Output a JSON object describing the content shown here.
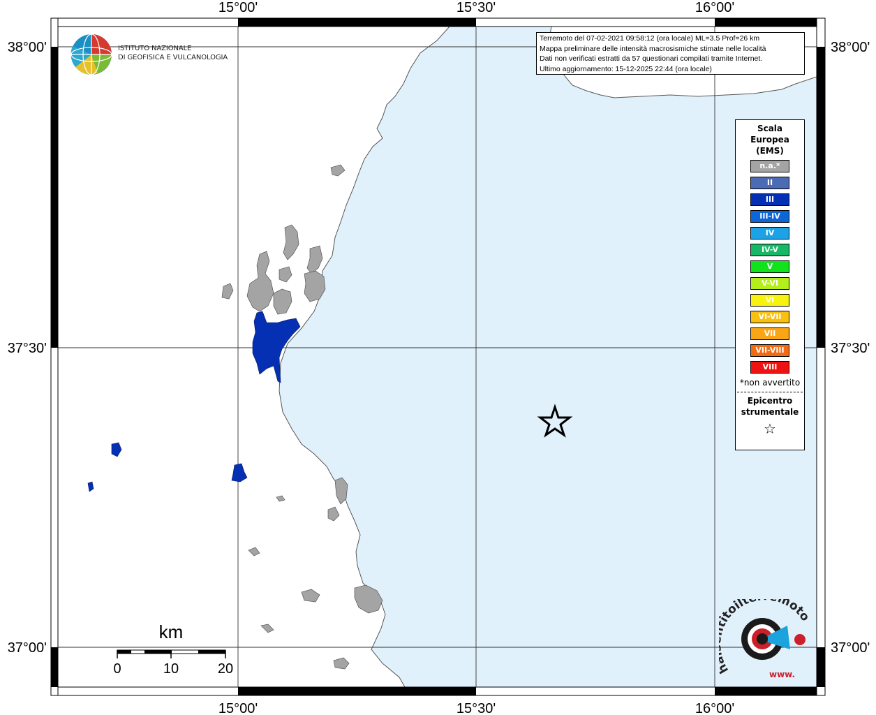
{
  "map": {
    "top_ticks": [
      "15°00'",
      "15°30'",
      "16°00'"
    ],
    "bottom_ticks": [
      "15°00'",
      "15°30'",
      "16°00'"
    ],
    "left_ticks": [
      "38°00'",
      "37°30'",
      "37°00'"
    ],
    "right_ticks": [
      "38°00'",
      "37°30'",
      "37°00'"
    ],
    "sea_color": "#e0f1fc",
    "land_color": "#ffffff",
    "locality_na_color": "#a4a4a4",
    "locality_iii_color": "#0530b4"
  },
  "info_box": {
    "lines": [
      "Terremoto del 07-02-2021 09:58:12 (ora locale) ML=3.5 Prof=26 km",
      "Mappa preliminare delle intensità macrosismiche stimate nelle località",
      "Dati non verificati estratti da 57 questionari compilati tramite Internet.",
      "Ultimo aggiornamento: 15-12-2025 22:44 (ora locale)"
    ]
  },
  "logo_ingv": {
    "line1": "ISTITUTO NAZIONALE",
    "line2": "DI GEOFISICA E VULCANOLOGIA"
  },
  "legend": {
    "title_lines": [
      "Scala",
      "Europea",
      "(EMS)"
    ],
    "items": [
      {
        "label": "n.a.*",
        "color": "#a4a4a4"
      },
      {
        "label": "II",
        "color": "#4c6bb5"
      },
      {
        "label": "III",
        "color": "#0530b4"
      },
      {
        "label": "III-IV",
        "color": "#0c66d8"
      },
      {
        "label": "IV",
        "color": "#1ea2e6"
      },
      {
        "label": "IV-V",
        "color": "#16b865"
      },
      {
        "label": "V",
        "color": "#10e21c"
      },
      {
        "label": "V-VI",
        "color": "#b4ef1c"
      },
      {
        "label": "VI",
        "color": "#f7f20e"
      },
      {
        "label": "VI-VII",
        "color": "#f9c00f"
      },
      {
        "label": "VII",
        "color": "#f9a516"
      },
      {
        "label": "VII-VIII",
        "color": "#f26a12"
      },
      {
        "label": "VIII",
        "color": "#ee1212"
      }
    ],
    "note": "*non avvertito",
    "epicenter_lines": [
      "Epicentro",
      "strumentale"
    ],
    "epicenter_symbol": "☆"
  },
  "scale_bar": {
    "unit": "km",
    "ticks": [
      "0",
      "10",
      "20"
    ]
  },
  "logo_hsit": {
    "text": "haisentitoilterremoto.it",
    "www": "www."
  }
}
